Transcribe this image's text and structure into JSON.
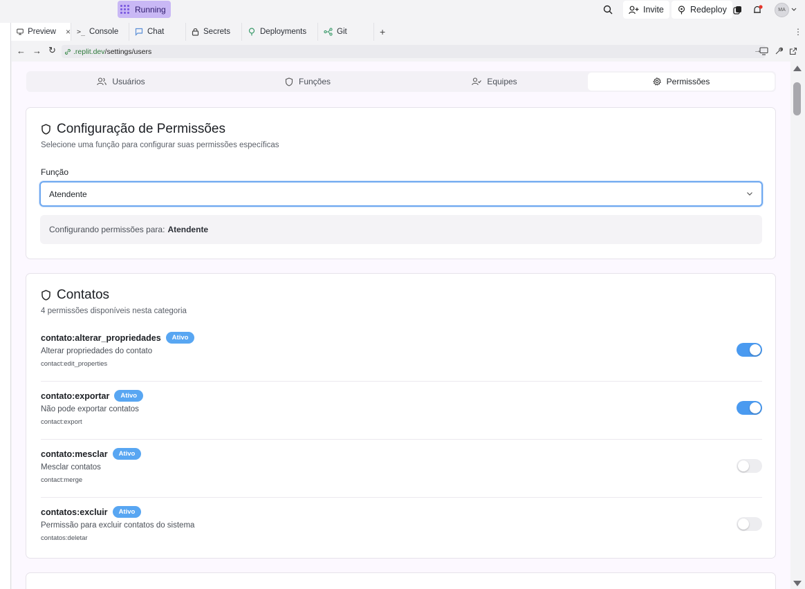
{
  "topbar": {
    "status": "Running",
    "invite": "Invite",
    "redeploy": "Redeploy",
    "avatar": "MA"
  },
  "tabs": [
    {
      "label": "Preview",
      "icon": "monitor-icon",
      "close": "×"
    },
    {
      "label": "Console",
      "icon": "terminal-icon"
    },
    {
      "label": "Chat",
      "icon": "chat-icon"
    },
    {
      "label": "Secrets",
      "icon": "lock-icon"
    },
    {
      "label": "Deployments",
      "icon": "deploy-icon"
    },
    {
      "label": "Git",
      "icon": "git-icon"
    }
  ],
  "add_tab": "+",
  "urlbar": {
    "domain": ".replit.dev",
    "path": "/settings/users"
  },
  "segments": [
    {
      "label": "Usuários",
      "icon": "users-icon"
    },
    {
      "label": "Funções",
      "icon": "shield-icon"
    },
    {
      "label": "Equipes",
      "icon": "team-icon"
    },
    {
      "label": "Permissões",
      "icon": "gear-icon",
      "active": true
    }
  ],
  "config": {
    "title": "Configuração de Permissões",
    "subtitle": "Selecione uma função para configurar suas permissões específicas",
    "field_label": "Função",
    "selected": "Atendente",
    "info_prefix": "Configurando permissões para:",
    "info_value": "Atendente"
  },
  "contatos": {
    "title": "Contatos",
    "subtitle": "4 permissões disponíveis nesta categoria",
    "items": [
      {
        "name": "contato:alterar_propriedades",
        "badge": "Ativo",
        "desc": "Alterar propriedades do contato",
        "key": "contact:edit_properties",
        "enabled": true
      },
      {
        "name": "contato:exportar",
        "badge": "Ativo",
        "desc": "Não pode exportar contatos",
        "key": "contact:export",
        "enabled": true
      },
      {
        "name": "contato:mesclar",
        "badge": "Ativo",
        "desc": "Mesclar contatos",
        "key": "contact:merge",
        "enabled": false
      },
      {
        "name": "contatos:excluir",
        "badge": "Ativo",
        "desc": "Permissão para excluir contatos do sistema",
        "key": "contatos:deletar",
        "enabled": false
      }
    ]
  },
  "colors": {
    "accent": "#4a9af0",
    "badge": "#58a6f2",
    "running": "#c9b8f5"
  }
}
